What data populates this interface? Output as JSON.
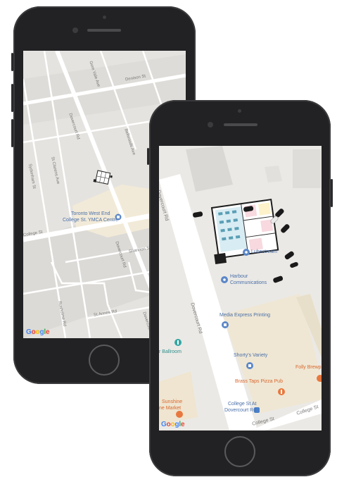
{
  "left_map": {
    "streets": {
      "gore_vale": "Gore Vale Ave",
      "denison": "Denison St",
      "dovercourt": "Dovercourt Rd",
      "bellwoods": "Bellwoods Ave",
      "st_clarens": "St Clarens Ave",
      "sydenham": "Sydenham St",
      "college_st": "College St",
      "dovercourt_2": "Dovercourt Rd",
      "shannon": "Shannon St",
      "dovercourt_3": "Dovercourt",
      "st_annes": "St Annes Rd",
      "rusholme": "Rusholme Rd"
    },
    "poi": {
      "ymca_line1": "Toronto West End",
      "ymca_line2": "College St. YMCA Centre"
    },
    "logo": "Google"
  },
  "right_map": {
    "streets": {
      "dovercourt_a": "Dovercourt Rd",
      "dovercourt_b": "Dovercourt Rd",
      "college_a": "College St",
      "college_b": "College St"
    },
    "poi": {
      "lubestream": "Lubestream",
      "communications_1": "Harbour",
      "communications_2": "Communications",
      "media_express": "Media Express Printing",
      "ballroom": "r Ballroom",
      "shortys": "Shorty's Variety",
      "folly": "Folly Brewp",
      "brass_taps": "Brass Taps Pizza Pub",
      "college_stop_1": "College St At",
      "college_stop_2": "Dovercourt Rd",
      "sunshine_1": "Sunshine",
      "sunshine_2": "ne Market"
    },
    "logo": "Google"
  },
  "colors": {
    "map_bg": "#e5e3df",
    "road": "#ffffff",
    "block": "#d6d4d0",
    "poi_blue": "#5b87c7",
    "poi_orange": "#e8783e",
    "poi_teal": "#34a6a3"
  }
}
